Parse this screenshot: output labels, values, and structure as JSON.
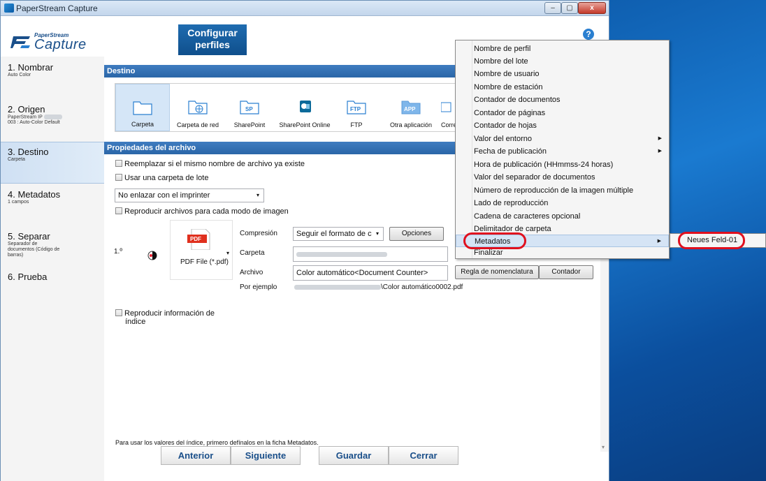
{
  "window": {
    "title": "PaperStream Capture",
    "minimize": "–",
    "maximize": "▢",
    "close": "x"
  },
  "header": {
    "logo_top": "PaperStream",
    "logo_main": "Capture",
    "tab_line1": "Configurar",
    "tab_line2": "perfiles",
    "help": "?"
  },
  "sidebar": {
    "steps": [
      {
        "title": "1. Nombrar",
        "sub": "Auto Color"
      },
      {
        "title": "2. Origen",
        "sub1": "PaperStream IP",
        "sub2": "003 : Auto-Color Default"
      },
      {
        "title": "3. Destino",
        "sub": "Carpeta"
      },
      {
        "title": "4. Metadatos",
        "sub": "1 campos"
      },
      {
        "title": "5. Separar",
        "sub1": "Separador de",
        "sub2": "documentos (Código de",
        "sub3": "barras)"
      },
      {
        "title": "6. Prueba"
      }
    ]
  },
  "destino": {
    "section": "Destino",
    "items": [
      {
        "label": "Carpeta",
        "icon": "folder-icon"
      },
      {
        "label": "Carpeta de red",
        "icon": "network-folder-icon"
      },
      {
        "label": "SharePoint",
        "icon": "sharepoint-icon",
        "badge": "SP"
      },
      {
        "label": "SharePoint Online",
        "icon": "sharepoint-online-icon"
      },
      {
        "label": "FTP",
        "icon": "ftp-icon",
        "badge": "FTP"
      },
      {
        "label": "Otra aplicación",
        "icon": "app-icon",
        "badge": "APP"
      },
      {
        "label": "Correo",
        "icon": "mail-icon"
      }
    ]
  },
  "props": {
    "section": "Propiedades del archivo",
    "replace": "Reemplazar si el mismo nombre de archivo ya existe",
    "batch_folder": "Usar una carpeta de lote",
    "imprinter": "No enlazar con el imprinter",
    "reproduce": "Reproducir archivos para cada modo de imagen",
    "index_line1": "Reproducir información de",
    "index_line2": "índice",
    "row_num": "1.º",
    "pdf_badge": "PDF",
    "pdf_label": "PDF File (*.pdf)",
    "compression_label": "Compresión",
    "compression_value": "Seguir el formato de c",
    "options": "Opciones",
    "folder_label": "Carpeta",
    "file_label": "Archivo",
    "file_value": "Color automático<Document Counter>",
    "naming_rule": "Regla de nomenclatura",
    "counter": "Contador",
    "example_label": "Por ejemplo",
    "example_value": "\\Color automático0002.pdf",
    "hint": "Para usar los valores del índice, primero defínalos en la ficha Metadatos."
  },
  "footer": {
    "prev": "Anterior",
    "next": "Siguiente",
    "save": "Guardar",
    "close": "Cerrar"
  },
  "menu": {
    "items": [
      "Nombre de perfil",
      "Nombre del lote",
      "Nombre de usuario",
      "Nombre de estación",
      "Contador de documentos",
      "Contador de páginas",
      "Contador de hojas",
      "Valor del entorno",
      "Fecha de publicación",
      "Hora de publicación (HHmmss-24 horas)",
      "Valor del separador de documentos",
      "Número de reproducción de la imagen múltiple",
      "Lado de reproducción",
      "Cadena de caracteres opcional",
      "Delimitador de carpeta",
      "Metadatos",
      "Finalizar"
    ],
    "submenu_item": "Neues Feld-01",
    "arrow": "▶"
  },
  "colors": {
    "accent": "#2a66a8",
    "highlight_oval": "#e0101e",
    "menu_highlight": "#d5e4f5"
  }
}
